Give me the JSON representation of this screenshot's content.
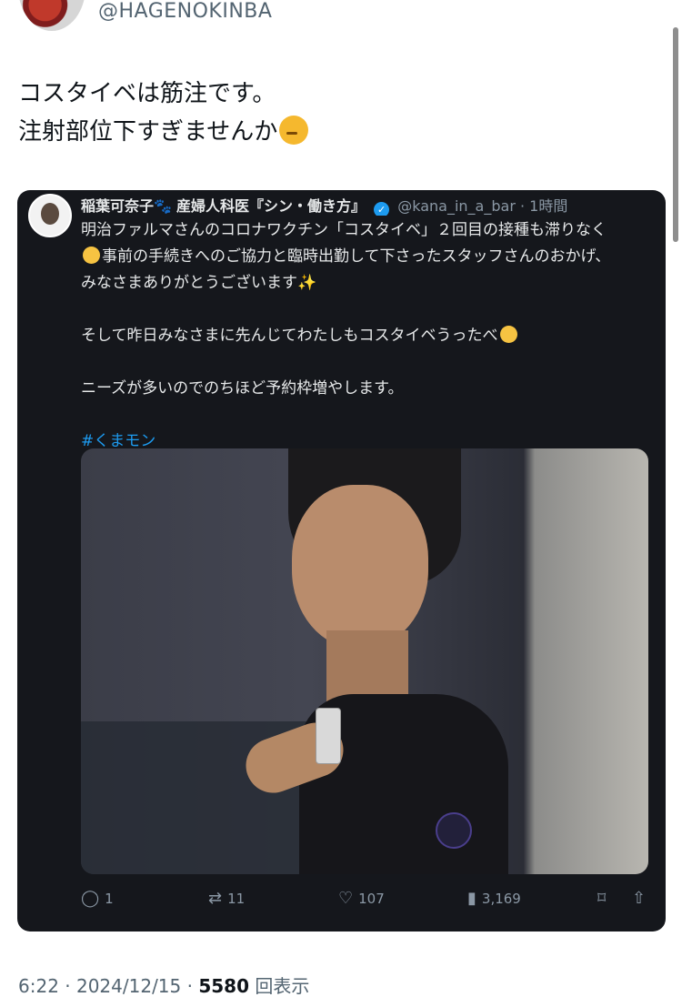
{
  "top": {
    "handle": "@HAGENOKINBA"
  },
  "tweet": {
    "line1": "コスタイベは筋注です。",
    "line2": "注射部位下すぎませんか",
    "emoji": "thinking-face-icon"
  },
  "quoted": {
    "name": "稲葉可奈子",
    "name_suffix": "産婦人科医『シン・働き方』",
    "handle_time": "@kana_in_a_bar · 1時間",
    "body_1": "明治ファルマさんのコロナワクチン「コスタイベ」２回目の接種も滞りなく",
    "body_2": "事前の手続きへのご協力と臨時出勤して下さったスタッフさんのおかげ、",
    "body_3": "みなさまありがとうございます",
    "body_4": "そして昨日みなさまに先んじてわたしもコスタイベうったべ",
    "body_5": "ニーズが多いのでのちほど予約枠増やします。",
    "hashtag": "#くまモン",
    "actions": {
      "replies": "1",
      "reposts": "11",
      "likes": "107",
      "views": "3,169"
    }
  },
  "footer": {
    "time_date": "6:22 · 2024/12/15 · ",
    "views_count": "5580",
    "views_label": " 回表示"
  },
  "colors": {
    "link": "#1d9bf0",
    "dark_bg": "#15171c",
    "muted": "#536471"
  }
}
